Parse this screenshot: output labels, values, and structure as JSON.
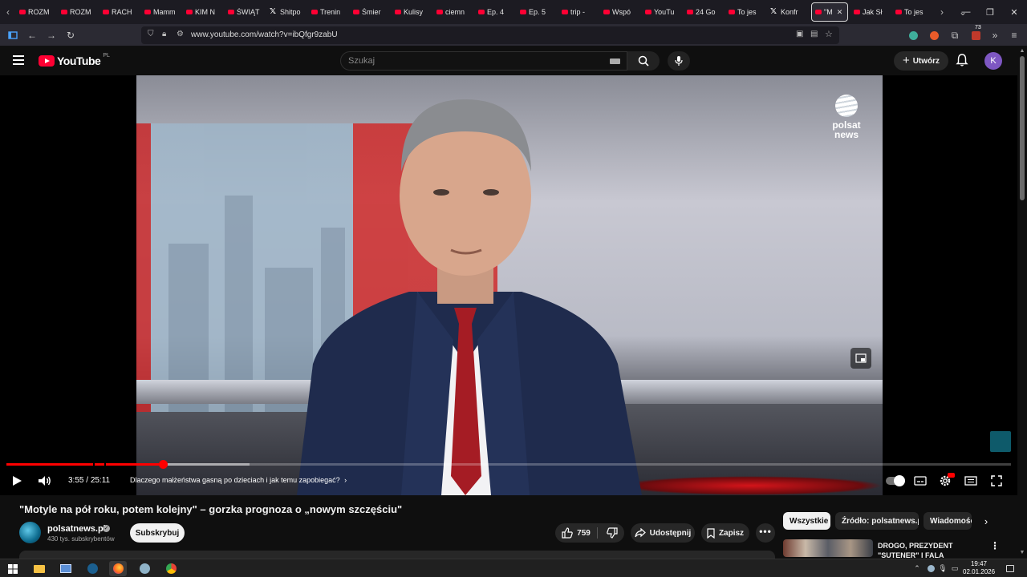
{
  "browser": {
    "tabs": [
      {
        "label": "ROZM",
        "favicon": "youtube"
      },
      {
        "label": "ROZM",
        "favicon": "youtube"
      },
      {
        "label": "RACH",
        "favicon": "youtube"
      },
      {
        "label": "Mamm",
        "favicon": "youtube"
      },
      {
        "label": "KIM N",
        "favicon": "youtube"
      },
      {
        "label": "ŚWIĄT",
        "favicon": "youtube"
      },
      {
        "label": "Shitpo",
        "favicon": "x"
      },
      {
        "label": "Trenin",
        "favicon": "youtube"
      },
      {
        "label": "Śmier",
        "favicon": "youtube"
      },
      {
        "label": "Kulisy",
        "favicon": "youtube"
      },
      {
        "label": "ciemn",
        "favicon": "youtube"
      },
      {
        "label": "Ep. 4",
        "favicon": "youtube"
      },
      {
        "label": "Ep. 5",
        "favicon": "youtube"
      },
      {
        "label": "trip - ",
        "favicon": "youtube"
      },
      {
        "label": "Wspó",
        "favicon": "youtube"
      },
      {
        "label": "YouTu",
        "favicon": "youtube"
      },
      {
        "label": "24 Go",
        "favicon": "youtube"
      },
      {
        "label": "To jes",
        "favicon": "youtube"
      },
      {
        "label": "Konfr",
        "favicon": "x"
      }
    ],
    "active_tab": {
      "label": "\"M",
      "favicon": "youtube"
    },
    "tabs_after": [
      {
        "label": "Jak Sł",
        "favicon": "youtube"
      },
      {
        "label": "To jes",
        "favicon": "youtube"
      }
    ],
    "url": "www.youtube.com/watch?v=ibQfgr9zabU",
    "extension_badge": "73"
  },
  "youtube": {
    "logo_text": "YouTube",
    "country_code": "PL",
    "search_placeholder": "Szukaj",
    "create_label": "Utwórz",
    "avatar_letter": "K"
  },
  "player": {
    "current_time": "3:55",
    "duration": "25:11",
    "time_separator": " / ",
    "chapter_title": "Dlaczego małżeństwa gasną po dzieciach i jak temu zapobiegać?",
    "progress_fraction": 0.156,
    "buffered_fraction": 0.242,
    "channel_logo_line1": "polsat",
    "channel_logo_line2": "news"
  },
  "video": {
    "title": "\"Motyle na pół roku, potem kolejny\" – gorzka prognoza o „nowym szczęściu\"",
    "channel_name": "polsatnews.pl",
    "subscribers": "430 tys. subskrybentów",
    "subscribe_label": "Subskrybuj",
    "likes": "759",
    "share_label": "Udostępnij",
    "save_label": "Zapisz"
  },
  "sidebar": {
    "chips": [
      "Wszystkie",
      "Źródło: polsatnews.pl",
      "Wiadomości"
    ],
    "recommendation_title": "DROGO, PREZYDENT \"SUTENER\" I FALA UKRAIŃCÓ..."
  },
  "taskbar": {
    "time": "19:47",
    "date": "02.01.2026"
  },
  "colors": {
    "youtube_red": "#ff0033",
    "progress_red": "#ff0000",
    "avatar_purple": "#7e57c2"
  }
}
